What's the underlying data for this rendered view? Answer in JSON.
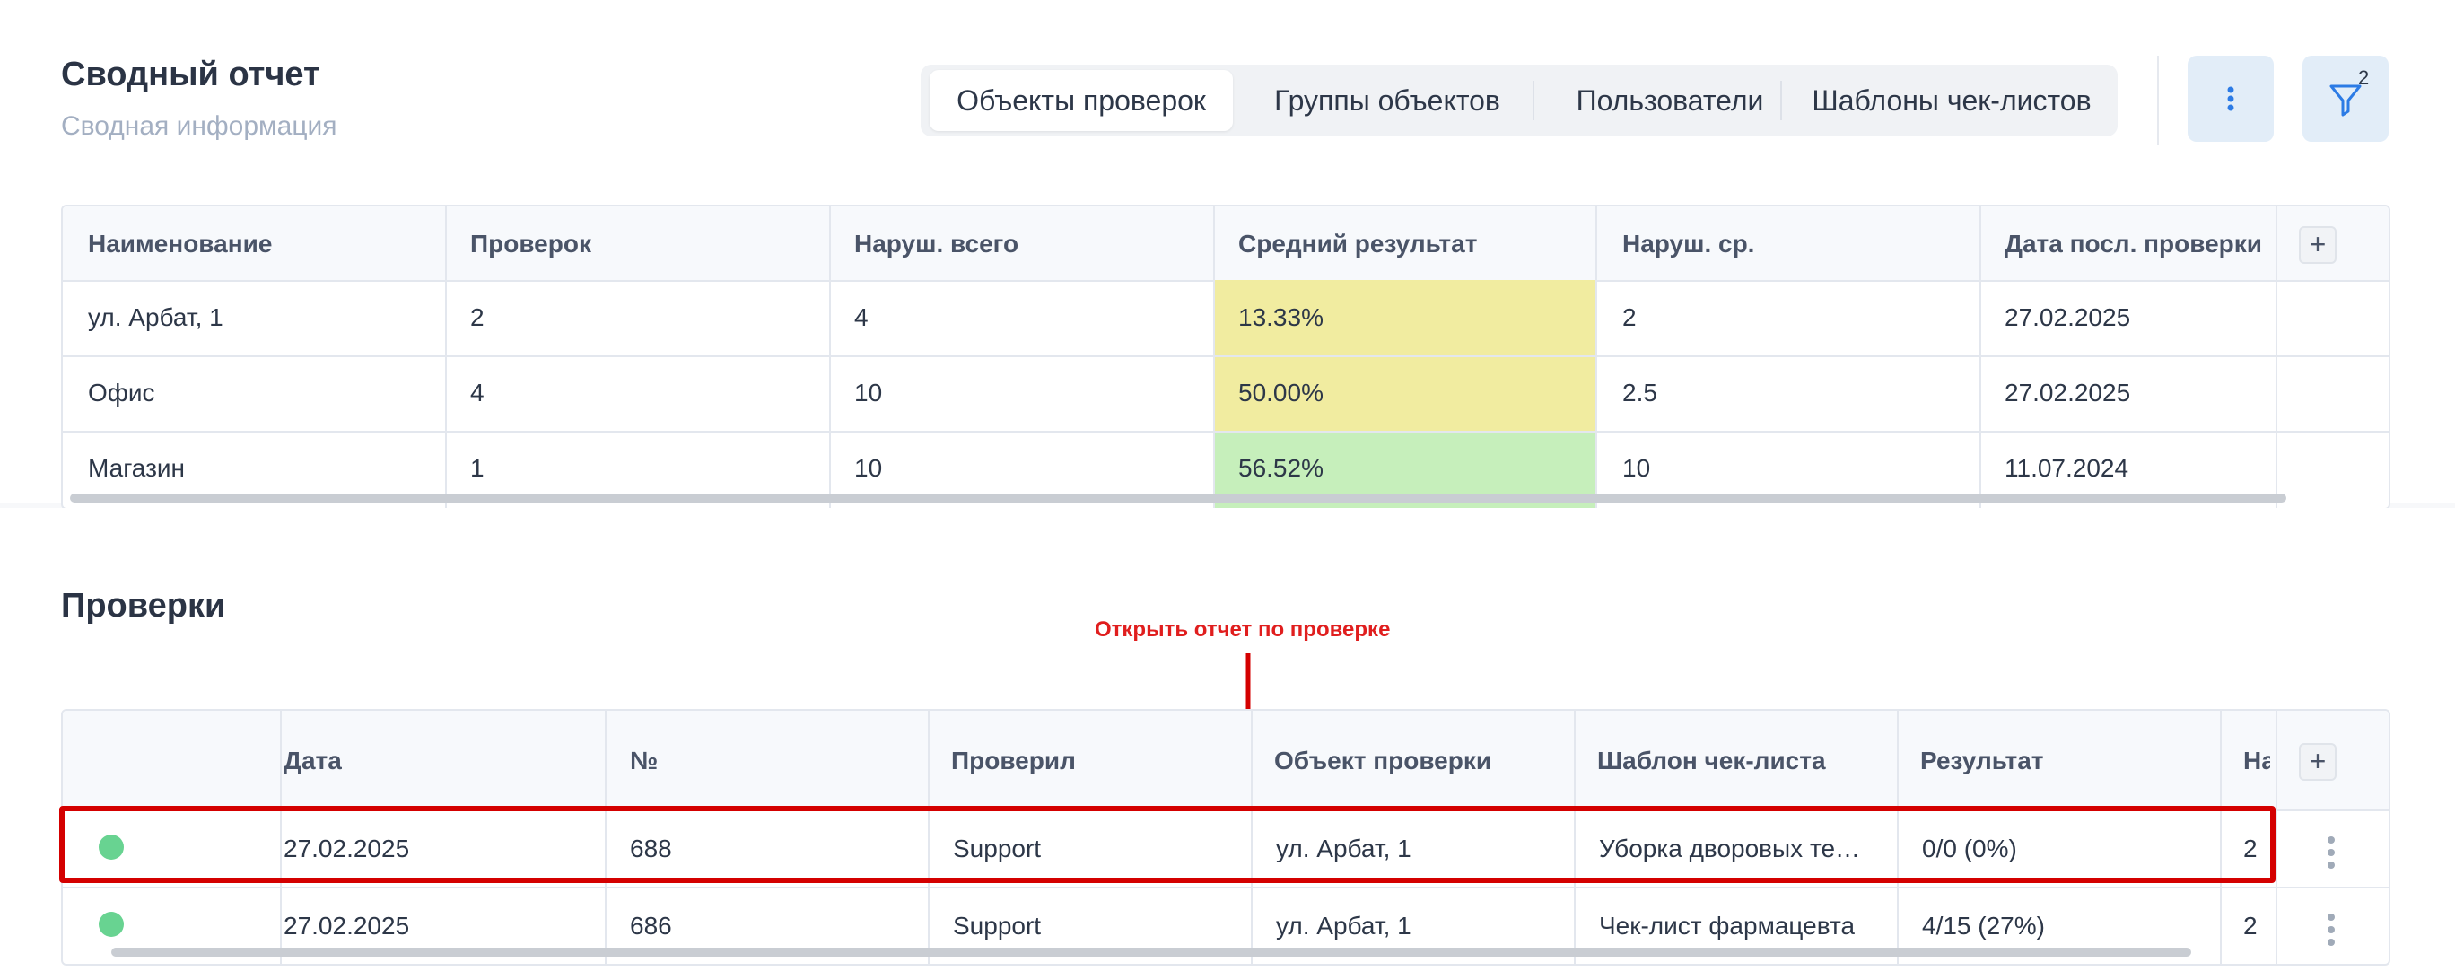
{
  "summary": {
    "title": "Сводный отчет",
    "subtitle": "Сводная информация",
    "tabs": [
      "Объекты проверок",
      "Группы объектов",
      "Пользователи",
      "Шаблоны чек-листов"
    ],
    "filter_badge": "2",
    "columns": [
      "Наименование",
      "Проверок",
      "Наруш. всего",
      "Средний результат",
      "Наруш. ср.",
      "Дата посл. проверки"
    ],
    "add_column": "+",
    "rows": [
      [
        "ул. Арбат, 1",
        "2",
        "4",
        "13.33%",
        "2",
        "27.02.2025"
      ],
      [
        "Офис",
        "4",
        "10",
        "50.00%",
        "2.5",
        "27.02.2025"
      ],
      [
        "Магазин",
        "1",
        "10",
        "56.52%",
        "10",
        "11.07.2024"
      ]
    ],
    "result_colors": [
      "#f1eca0",
      "#f1eca0",
      "#c6efbb"
    ]
  },
  "checks": {
    "title": "Проверки",
    "annotation": "Открыть отчет по проверке",
    "columns": [
      "",
      "Дата",
      "№",
      "Проверил",
      "Объект проверки",
      "Шаблон чек-листа",
      "Результат",
      "На"
    ],
    "add_column": "+",
    "rows": [
      [
        "",
        "27.02.2025",
        "688",
        "Support",
        "ул. Арбат, 1",
        "Уборка дворовых те…",
        "0/0 (0%)",
        "2"
      ],
      [
        "",
        "27.02.2025",
        "686",
        "Support",
        "ул. Арбат, 1",
        "Чек-лист фармацевта",
        "4/15 (27%)",
        "2"
      ]
    ],
    "status_color": "#68d391"
  },
  "icons": {
    "more": "vertical-dots-icon",
    "filter": "filter-icon",
    "row_menu": "kebab-icon",
    "status": "status-dot-icon"
  },
  "colors": {
    "accent": "#2c7be5",
    "annotation_red": "#d40000"
  }
}
